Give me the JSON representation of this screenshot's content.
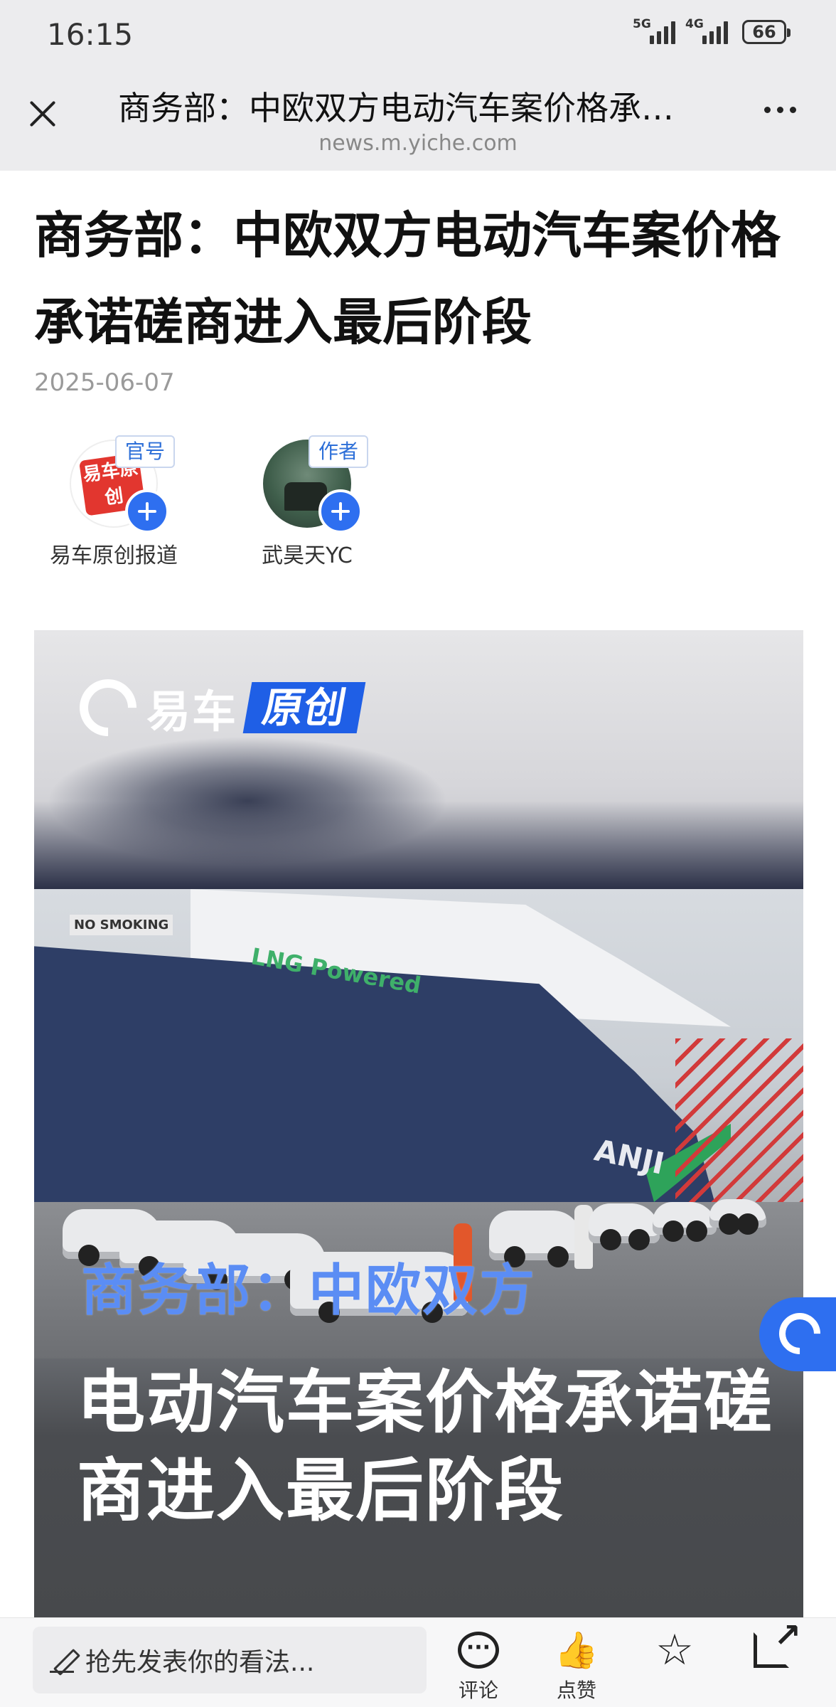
{
  "status_bar": {
    "time": "16:15",
    "signal1_tag": "5G",
    "signal2_tag": "4G",
    "battery": "66"
  },
  "nav": {
    "title": "商务部：中欧双方电动汽车案价格承诺磋商进入最后阶段",
    "url": "news.m.yiche.com",
    "close_icon": "close-icon",
    "more_icon": "more-icon"
  },
  "article": {
    "title": "商务部：中欧双方电动汽车案价格承诺磋商进入最后阶段",
    "date": "2025-06-07",
    "authors": [
      {
        "badge": "官号",
        "name": "易车原创报道",
        "avatar_text": "易车原创"
      },
      {
        "badge": "作者",
        "name": "武昊天YC"
      }
    ]
  },
  "hero": {
    "brand_name": "易车",
    "brand_tag": "原创",
    "photo_text_1": "NO SMOKING",
    "photo_text_2": "LNG Powered",
    "photo_text_3": "ANJI",
    "caption_line1": "商务部：中欧双方",
    "caption_line2": "电动汽车案价格承诺磋商进入最后阶段"
  },
  "bottom_bar": {
    "input_placeholder": "抢先发表你的看法...",
    "comment_label": "评论",
    "like_label": "点赞",
    "favorite_icon": "star-icon",
    "share_icon": "share-icon"
  },
  "colors": {
    "accent": "#2e6ff0",
    "brand_red": "#e2362f",
    "caption_blue": "#5b8df4"
  }
}
